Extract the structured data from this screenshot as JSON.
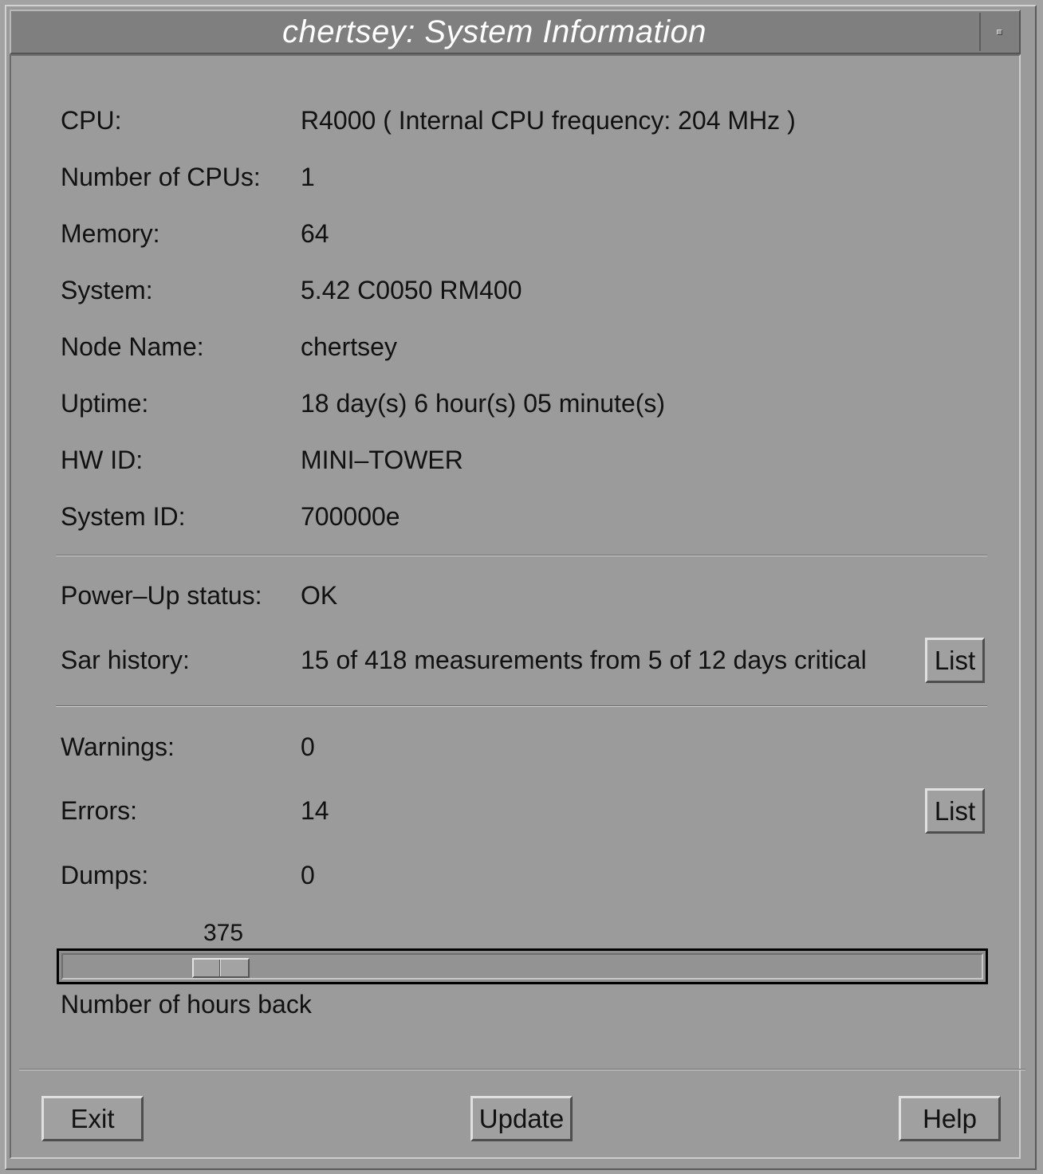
{
  "window": {
    "title": "chertsey: System Information"
  },
  "info": [
    {
      "label": "CPU:",
      "value": "R4000 ( Internal CPU frequency: 204 MHz )"
    },
    {
      "label": "Number of CPUs:",
      "value": "1"
    },
    {
      "label": "Memory:",
      "value": "64"
    },
    {
      "label": "System:",
      "value": "5.42 C0050 RM400"
    },
    {
      "label": "Node Name:",
      "value": "chertsey"
    },
    {
      "label": "Uptime:",
      "value": "18 day(s) 6 hour(s) 05 minute(s)"
    },
    {
      "label": "HW ID:",
      "value": "MINI–TOWER"
    },
    {
      "label": "System ID:",
      "value": "700000e"
    }
  ],
  "status": {
    "powerup_label": "Power–Up status:",
    "powerup_value": "OK",
    "sar_label": "Sar history:",
    "sar_value": "15 of 418 measurements from 5 of 12 days critical",
    "sar_list_button": "List"
  },
  "counts": {
    "warnings_label": "Warnings:",
    "warnings_value": "0",
    "errors_label": "Errors:",
    "errors_value": "14",
    "errors_list_button": "List",
    "dumps_label": "Dumps:",
    "dumps_value": "0"
  },
  "slider": {
    "value": "375",
    "caption": "Number of hours back",
    "fraction": 0.15
  },
  "footer": {
    "exit_label": "Exit",
    "update_label": "Update",
    "help_label": "Help"
  }
}
